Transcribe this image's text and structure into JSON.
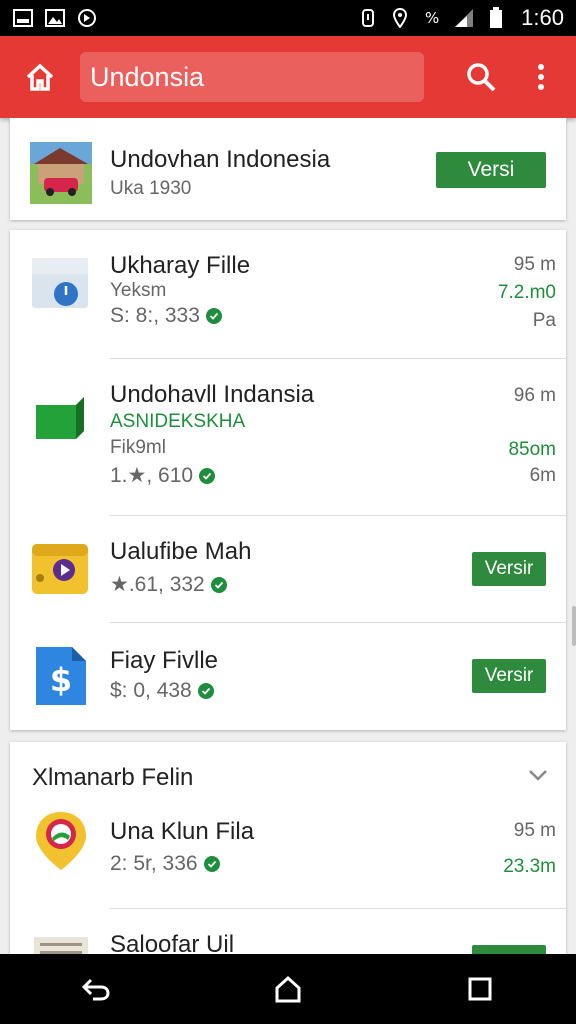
{
  "status_bar": {
    "time": "1:60"
  },
  "app_bar": {
    "search_text": "Undonsia"
  },
  "featured": {
    "title": "Undovhan Indonesia",
    "subtitle": "Uka 1930",
    "button": "Versi"
  },
  "list1": [
    {
      "title": "Ukharay Fille",
      "subtitle": "Yeksm",
      "rating": "S: 8:, 333",
      "meta": [
        "95 m",
        "7.2.m0",
        "Pa"
      ],
      "meta_green": [
        false,
        true,
        false
      ]
    },
    {
      "title": "Undohavll Indansia",
      "subtitle_green": "ASNIDEKSKHA",
      "subtitle": "Fik9ml",
      "rating": "1.★, 610",
      "meta": [
        "96 m",
        "85om",
        "6m"
      ],
      "meta_green": [
        false,
        true,
        false
      ]
    },
    {
      "title": "Ualufibe Mah",
      "rating": "★.61, 332",
      "button": "Versir"
    },
    {
      "title": "Fiay Fivlle",
      "rating": "$: 0, 438",
      "button": "Versir"
    }
  ],
  "section2": {
    "title": "Xlmanarb Felin",
    "items": [
      {
        "title": "Una Klun Fila",
        "rating": "2: 5r, 336",
        "meta": [
          "95 m",
          "23.3m"
        ],
        "meta_green": [
          false,
          true
        ]
      },
      {
        "title": "Saloofar Uil"
      }
    ]
  },
  "colors": {
    "primary": "#e53935",
    "accent_green": "#2e8b3e"
  },
  "icons": [
    "home-icon",
    "search-icon",
    "more-vert-icon",
    "back-icon",
    "home-nav-icon",
    "recents-icon",
    "chevron-down-icon",
    "check-icon"
  ]
}
